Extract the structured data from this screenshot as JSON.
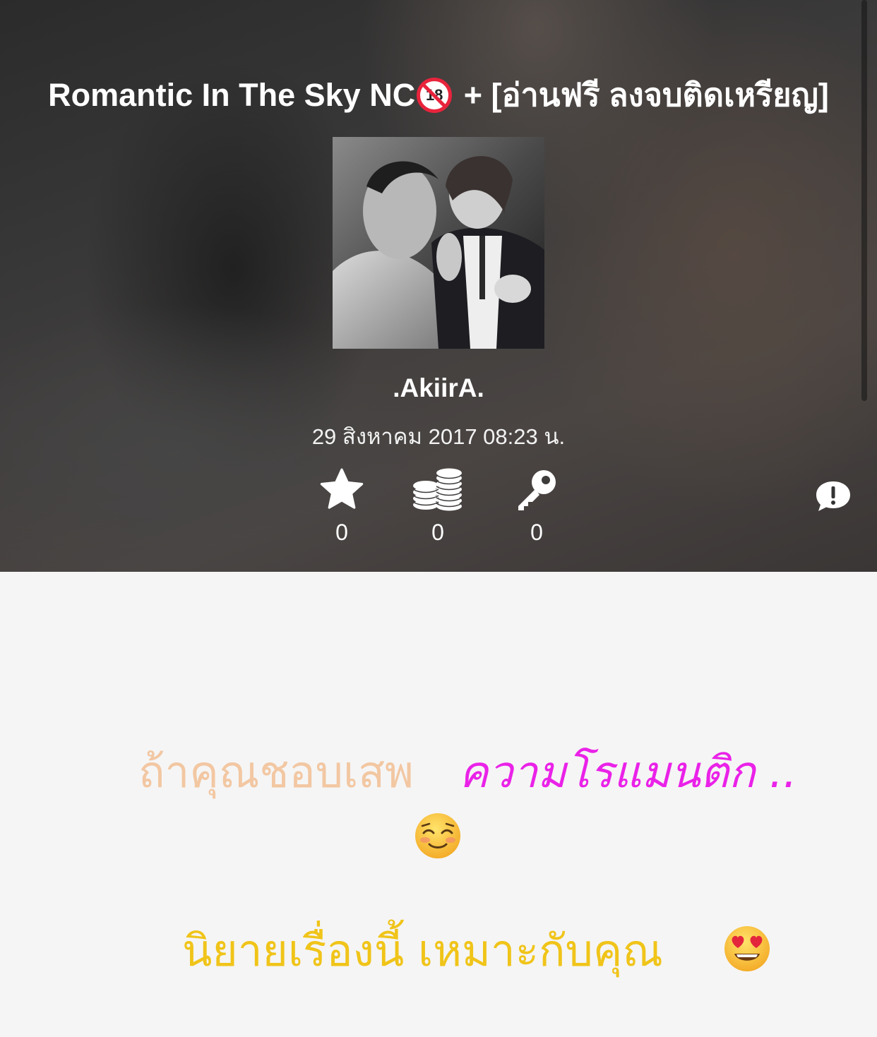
{
  "header": {
    "title_before_badge": "Romantic In The Sky NC",
    "badge_number": "18",
    "title_after_badge": " +  [อ่านฟรี ลงจบติดเหรียญ]",
    "author": ".AkiirA.",
    "date": "29 สิงหาคม 2017 08:23 น.",
    "stats": [
      {
        "icon": "star-icon",
        "count": "0"
      },
      {
        "icon": "coins-icon",
        "count": "0"
      },
      {
        "icon": "key-icon",
        "count": "0"
      }
    ],
    "report_icon": "report-bubble-icon",
    "colors": {
      "badge_red": "#e8243c"
    }
  },
  "content": {
    "line1_part_a": "ถ้าคุณชอบเสพ",
    "line1_part_b": "ความโรแมนติก ..",
    "emoji_1": "smiling-blush-emoji",
    "line2": "นิยายเรื่องนี้ เหมาะกับคุณ",
    "emoji_2": "heart-eyes-emoji",
    "colors": {
      "peach": "#f2c7a2",
      "magenta": "#ea22e8",
      "gold": "#f0c419"
    }
  }
}
